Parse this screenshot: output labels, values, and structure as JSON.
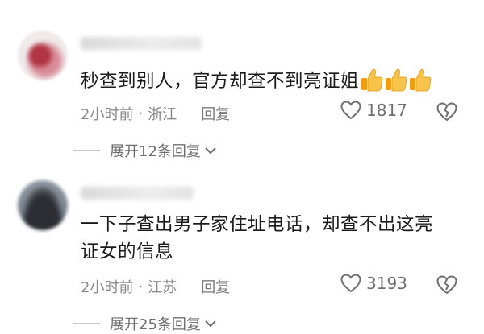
{
  "comments": [
    {
      "text": "秒查到别人，官方却查不到亮证姐",
      "emojis": [
        "thumbs-up-icon",
        "thumbs-up-icon",
        "thumbs-up-icon"
      ],
      "time": "2小时前",
      "separator": "·",
      "location": "浙江",
      "reply_label": "回复",
      "likes": "1817",
      "expand_label": "展开12条回复"
    },
    {
      "text_line1": "一下子查出男子家住址电话，却查不出这亮",
      "text_line2": "证女的信息",
      "time": "2小时前",
      "separator": "·",
      "location": "江苏",
      "reply_label": "回复",
      "likes": "3193",
      "expand_label": "展开25条回复"
    }
  ],
  "colors": {
    "text": "#1b1b1b",
    "meta": "#8a8a8a",
    "icon": "#6f6f6f",
    "thumb": "#f6b93b"
  }
}
